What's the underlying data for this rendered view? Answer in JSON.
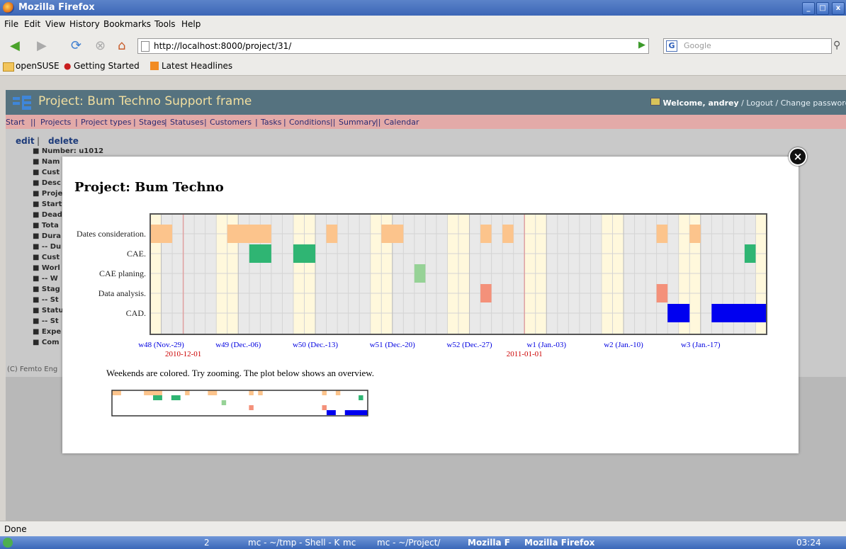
{
  "window": {
    "title": "Mozilla Firefox"
  },
  "menu": [
    "File",
    "Edit",
    "View",
    "History",
    "Bookmarks",
    "Tools",
    "Help"
  ],
  "nav": {
    "url": "http://localhost:8000/project/31/",
    "search_placeholder": "Google"
  },
  "bookmarks": [
    "openSUSE",
    "Getting Started",
    "Latest Headlines"
  ],
  "page": {
    "title": "Project: Bum Techno Support frame",
    "welcome_user": "Welcome, andrey",
    "logout": "/ Logout",
    "change_password": "/ Change password",
    "nav_items": [
      "Start",
      "||",
      "Projects",
      "|",
      "Project types",
      "|",
      "Stages",
      "|",
      "Statuses",
      "|",
      "Customers",
      "|",
      "Tasks",
      "|",
      "Conditions",
      "||",
      "Summary",
      "||",
      "Calendar"
    ],
    "edit": "edit",
    "separator": "|",
    "delete": "delete",
    "fields": [
      "Number: u1012",
      "Nam",
      "Cust",
      "Desc",
      "Proje",
      "Start",
      "Dead",
      "Tota",
      "Dura",
      "-- Du",
      "Cust",
      "Worl",
      "-- W",
      "Stag",
      "-- St",
      "Statu",
      "-- St",
      "Expe",
      "Com"
    ],
    "footer": "(C) Femto Eng"
  },
  "modal": {
    "title": "Project: Bum Techno",
    "note": "Weekends are colored. Try zooming. The plot below shows an overview.",
    "close_glyph": "×"
  },
  "chart_data": {
    "type": "gantt",
    "rows": [
      "Dates consideration.",
      "CAE.",
      "CAE planing.",
      "Data analysis.",
      "CAD."
    ],
    "x_range": [
      "2010-11-28",
      "2011-01-23"
    ],
    "week_labels": [
      "w48 (Nov.-29)",
      "w49 (Dec.-06)",
      "w50 (Dec.-13)",
      "w51 (Dec.-20)",
      "w52 (Dec.-27)",
      "w1 (Jan.-03)",
      "w2 (Jan.-10)",
      "w3 (Jan.-17)"
    ],
    "week_dates": [
      "2010-11-29",
      "2010-12-06",
      "2010-12-13",
      "2010-12-20",
      "2010-12-27",
      "2011-01-03",
      "2011-01-10",
      "2011-01-17"
    ],
    "year_markers": [
      {
        "date": "2010-12-01",
        "label": "2010-12-01"
      },
      {
        "date": "2011-01-01",
        "label": "2011-01-01"
      }
    ],
    "weekends_colored": true,
    "colors": {
      "Dates consideration.": "#fcc48c",
      "CAE.": "#2fb573",
      "CAE planing.": "#96d296",
      "Data analysis.": "#f4917a",
      "CAD.": "#0000f0",
      "weekend": "#fff8dc",
      "week_label": "#0000e0",
      "year_marker": "#cc0000"
    },
    "tasks": [
      {
        "row": "Dates consideration.",
        "start": "2010-11-28",
        "end": "2010-11-30"
      },
      {
        "row": "Dates consideration.",
        "start": "2010-12-05",
        "end": "2010-12-09"
      },
      {
        "row": "Dates consideration.",
        "start": "2010-12-14",
        "end": "2010-12-15"
      },
      {
        "row": "Dates consideration.",
        "start": "2010-12-19",
        "end": "2010-12-21"
      },
      {
        "row": "Dates consideration.",
        "start": "2010-12-28",
        "end": "2010-12-29"
      },
      {
        "row": "Dates consideration.",
        "start": "2010-12-30",
        "end": "2010-12-31"
      },
      {
        "row": "Dates consideration.",
        "start": "2011-01-13",
        "end": "2011-01-14"
      },
      {
        "row": "Dates consideration.",
        "start": "2011-01-16",
        "end": "2011-01-17"
      },
      {
        "row": "CAE.",
        "start": "2010-12-07",
        "end": "2010-12-09"
      },
      {
        "row": "CAE.",
        "start": "2010-12-11",
        "end": "2010-12-13"
      },
      {
        "row": "CAE.",
        "start": "2011-01-21",
        "end": "2011-01-22"
      },
      {
        "row": "CAE planing.",
        "start": "2010-12-22",
        "end": "2010-12-23"
      },
      {
        "row": "Data analysis.",
        "start": "2010-12-28",
        "end": "2010-12-29"
      },
      {
        "row": "Data analysis.",
        "start": "2011-01-13",
        "end": "2011-01-14"
      },
      {
        "row": "CAD.",
        "start": "2011-01-14",
        "end": "2011-01-16"
      },
      {
        "row": "CAD.",
        "start": "2011-01-18",
        "end": "2011-01-23"
      }
    ]
  },
  "statusbar": {
    "text": "Done"
  },
  "taskbar": {
    "items": [
      "2",
      "mc - ~/tmp - Shell - K",
      "mc",
      "mc - ~/Project/",
      "Mozilla F",
      "Mozilla Firefox"
    ],
    "clock": "03:24"
  }
}
